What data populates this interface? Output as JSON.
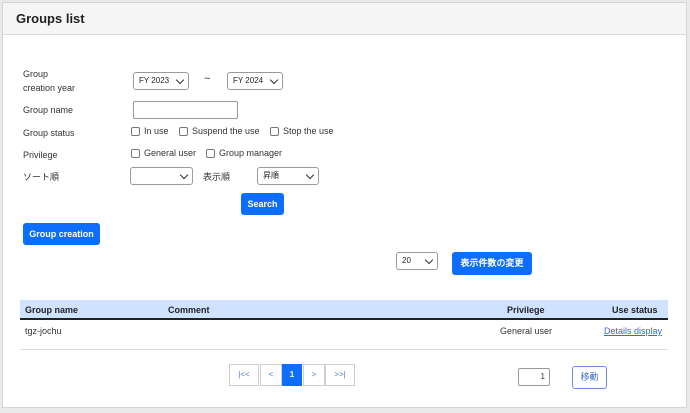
{
  "header": {
    "title": "Groups list"
  },
  "form": {
    "year_label_line1": "Group",
    "year_label_line2": "creation year",
    "year_from": "FY 2023",
    "year_sep": "~",
    "year_to": "FY 2024",
    "name_label": "Group name",
    "name_value": "",
    "status_label": "Group status",
    "status_options": [
      "In use",
      "Suspend the use",
      "Stop the use"
    ],
    "privilege_label": "Privilege",
    "privilege_options": [
      "General user",
      "Group manager"
    ],
    "sort_label": "ソート順",
    "sort_value": "",
    "order_label": "表示順",
    "order_value": "昇順",
    "search_button": "Search"
  },
  "actions": {
    "create_button": "Group creation",
    "page_size": "20",
    "page_size_button": "表示件数の変更"
  },
  "table": {
    "headers": [
      "Group name",
      "Comment",
      "Privilege",
      "Use status"
    ],
    "rows": [
      {
        "name": "tgz-jochu",
        "comment": "",
        "privilege": "General user",
        "status": "Details display"
      }
    ]
  },
  "pagination": {
    "first": "|<<",
    "prev": "<",
    "current": "1",
    "next": ">",
    "last": ">>|",
    "jump_value": "1",
    "jump_button": "移動"
  }
}
